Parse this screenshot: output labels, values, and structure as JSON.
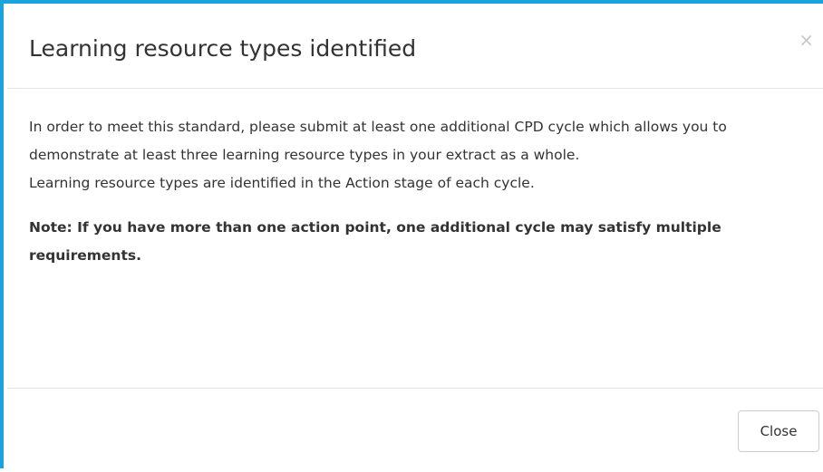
{
  "modal": {
    "title": "Learning resource types identified",
    "close_icon": "×",
    "body": {
      "paragraph": "In order to meet this standard, please submit at least one additional CPD cycle which allows you to demonstrate at least three learning resource types in your extract as a whole.",
      "paragraph2": "Learning resource types are identified in the Action stage of each cycle.",
      "note": "Note: If you have more than one action point, one additional cycle may satisfy multiple requirements."
    },
    "footer": {
      "close_label": "Close"
    }
  },
  "colors": {
    "accent_border": "#1ba3dd",
    "divider": "#e5e5e5",
    "text": "#333333"
  },
  "icons": {
    "close": "close-icon"
  }
}
